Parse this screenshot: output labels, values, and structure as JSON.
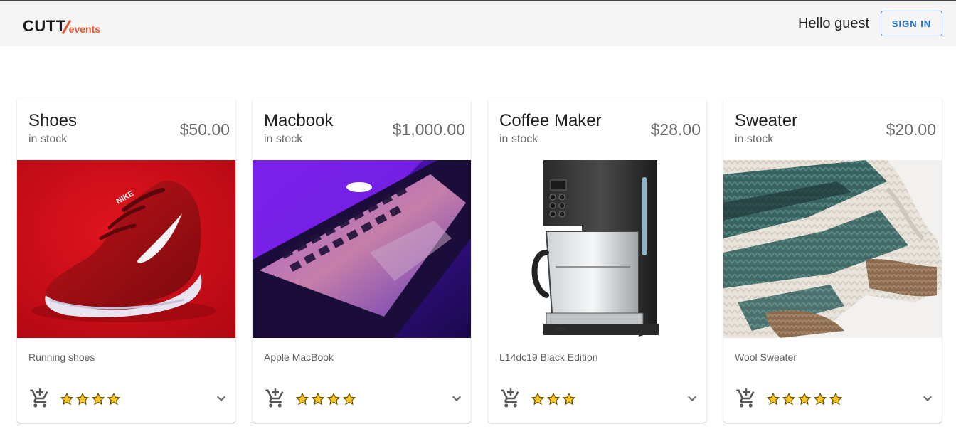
{
  "header": {
    "logo_main": "CUTT",
    "logo_sub": "events",
    "greeting": "Hello guest",
    "signin_label": "SIGN IN",
    "colors": {
      "background": "#f5f5f5",
      "brand_accent": "#e4572e",
      "signin": "#1f6fc6"
    }
  },
  "products": [
    {
      "title": "Shoes",
      "stock": "in stock",
      "price": "$50.00",
      "description": "Running shoes",
      "rating": 4,
      "image": "red-nike-running-shoe"
    },
    {
      "title": "Macbook",
      "stock": "in stock",
      "price": "$1,000.00",
      "description": "Apple MacBook",
      "rating": 4,
      "image": "purple-lit-laptop-keyboard"
    },
    {
      "title": "Coffee Maker",
      "stock": "in stock",
      "price": "$28.00",
      "description": "L14dc19 Black Edition",
      "rating": 3,
      "image": "black-drip-coffee-maker"
    },
    {
      "title": "Sweater",
      "stock": "in stock",
      "price": "$20.00",
      "description": "Wool Sweater",
      "rating": 5,
      "image": "knitted-wool-sweater"
    }
  ],
  "icons": {
    "cart": "add-shopping-cart-icon",
    "star": "star-icon",
    "expand": "chevron-down-icon"
  }
}
